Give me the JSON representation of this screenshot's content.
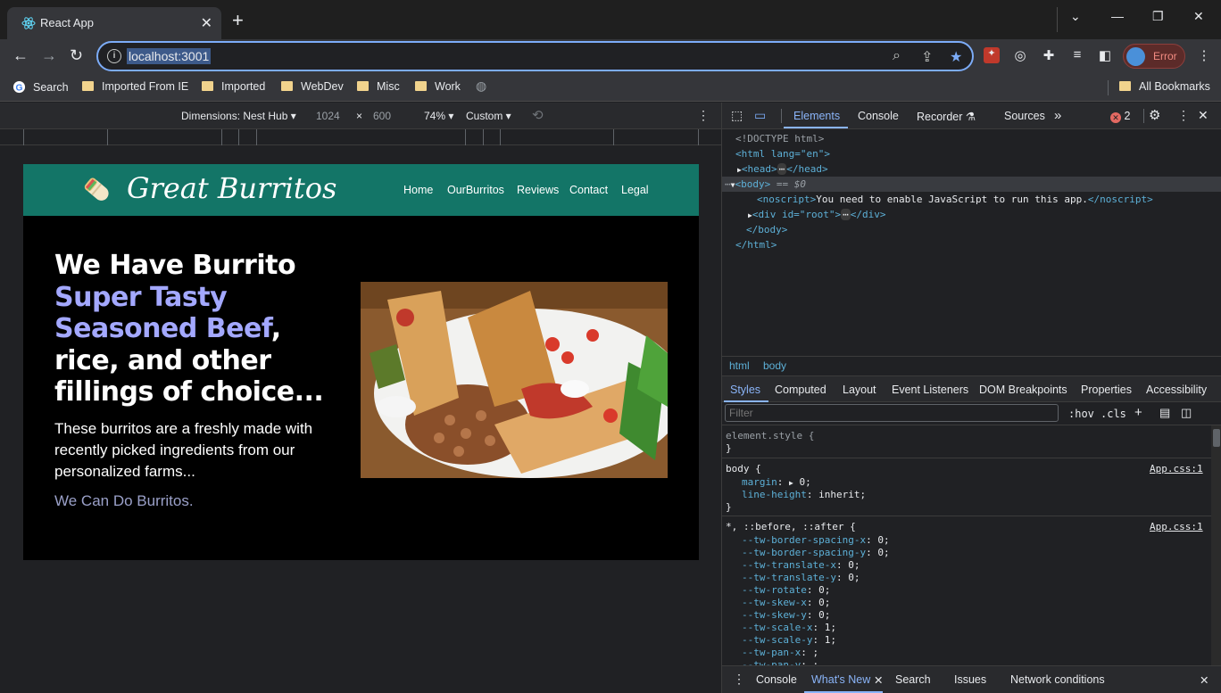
{
  "browser": {
    "tab_title": "React App",
    "url": "localhost:3001",
    "profile_label": "Error",
    "bookmarks": [
      "Search",
      "Imported From IE",
      "Imported",
      "WebDev",
      "Misc",
      "Work"
    ],
    "all_bookmarks": "All Bookmarks"
  },
  "device_toolbar": {
    "dimensions": "Dimensions: Nest Hub",
    "width": "1024",
    "times": "×",
    "height": "600",
    "zoom": "74%",
    "throttle": "Custom"
  },
  "site": {
    "logo": "Great Burritos",
    "nav": [
      "Home",
      "OurBurritos",
      "Reviews",
      "Contact",
      "Legal"
    ],
    "hero_line1": "We Have Burrito",
    "hero_highlight": "Super Tasty Seasoned Beef",
    "hero_comma": ",",
    "hero_rest": "rice, and other fillings of choice...",
    "hero_paragraph": "These burritos are a freshly made with recently picked ingredients from our personalized farms...",
    "hero_sub": "We Can Do Burritos."
  },
  "devtools": {
    "tabs": [
      "Elements",
      "Console",
      "Recorder",
      "Sources"
    ],
    "error_count": "2",
    "dom": {
      "doctype": "<!DOCTYPE html>",
      "html_open": "<html lang=\"en\">",
      "head": "<head>",
      "head_close": "</head>",
      "body": "<body>",
      "body_sel": "== $0",
      "noscript_open": "<noscript>",
      "noscript_text": "You need to enable JavaScript to run this app.",
      "noscript_close": "</noscript>",
      "div_open": "<div id=\"root\">",
      "div_close": "</div>",
      "body_close": "</body>",
      "html_close": "</html>"
    },
    "breadcrumbs": [
      "html",
      "body"
    ],
    "subtabs": [
      "Styles",
      "Computed",
      "Layout",
      "Event Listeners",
      "DOM Breakpoints",
      "Properties",
      "Accessibility"
    ],
    "filter_placeholder": "Filter",
    "hov": ":hov",
    "cls": ".cls",
    "styles": {
      "element_style": "element.style {",
      "close": "}",
      "body_selector": "body {",
      "source1": "App.css:1",
      "margin_prop": "margin",
      "margin_val": "0;",
      "lh_prop": "line-height",
      "lh_val": "inherit;",
      "universal_selector": "*, ::before, ::after {",
      "source2": "App.css:1",
      "vars": [
        {
          "p": "--tw-border-spacing-x",
          "v": "0;"
        },
        {
          "p": "--tw-border-spacing-y",
          "v": "0;"
        },
        {
          "p": "--tw-translate-x",
          "v": "0;"
        },
        {
          "p": "--tw-translate-y",
          "v": "0;"
        },
        {
          "p": "--tw-rotate",
          "v": "0;"
        },
        {
          "p": "--tw-skew-x",
          "v": "0;"
        },
        {
          "p": "--tw-skew-y",
          "v": "0;"
        },
        {
          "p": "--tw-scale-x",
          "v": "1;"
        },
        {
          "p": "--tw-scale-y",
          "v": "1;"
        },
        {
          "p": "--tw-pan-x",
          "v": ";"
        },
        {
          "p": "--tw-pan-y",
          "v": ";"
        }
      ]
    },
    "drawer": [
      "Console",
      "What's New",
      "Search",
      "Issues",
      "Network conditions"
    ]
  }
}
